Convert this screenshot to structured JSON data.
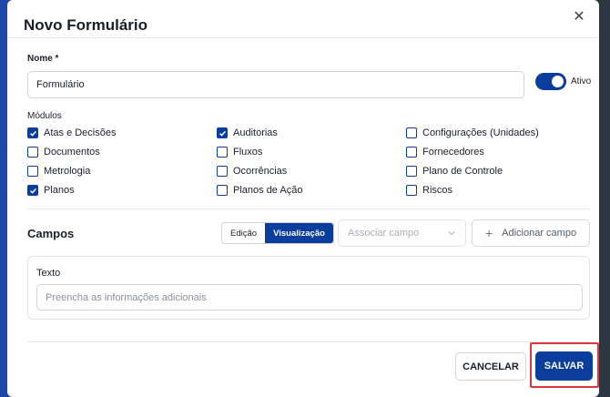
{
  "modal": {
    "title": "Novo Formulário",
    "close_icon": "close-icon"
  },
  "name_field": {
    "label": "Nome *",
    "value": "Formulário"
  },
  "toggle": {
    "label": "Ativo",
    "on": true
  },
  "modules": {
    "label": "Módulos",
    "items": [
      {
        "label": "Atas e Decisões",
        "checked": true
      },
      {
        "label": "Auditorias",
        "checked": true
      },
      {
        "label": "Configurações (Unidades)",
        "checked": false
      },
      {
        "label": "Documentos",
        "checked": false
      },
      {
        "label": "Fluxos",
        "checked": false
      },
      {
        "label": "Fornecedores",
        "checked": false
      },
      {
        "label": "Metrologia",
        "checked": false
      },
      {
        "label": "Ocorrências",
        "checked": false
      },
      {
        "label": "Plano de Controle",
        "checked": false
      },
      {
        "label": "Planos",
        "checked": true
      },
      {
        "label": "Planos de Ação",
        "checked": false
      },
      {
        "label": "Riscos",
        "checked": false
      }
    ]
  },
  "fields_section": {
    "title": "Campos",
    "mode_tabs": [
      {
        "label": "Edição",
        "active": false
      },
      {
        "label": "Visualização",
        "active": true
      }
    ],
    "associate_placeholder": "Associar campo",
    "add_field_label": "Adicionar campo"
  },
  "text_field": {
    "label": "Texto",
    "placeholder": "Preencha as informações adicionais"
  },
  "footer": {
    "cancel_label": "CANCELAR",
    "save_label": "SALVAR"
  },
  "colors": {
    "primary": "#0a3d9c",
    "highlight": "#d9363e"
  }
}
